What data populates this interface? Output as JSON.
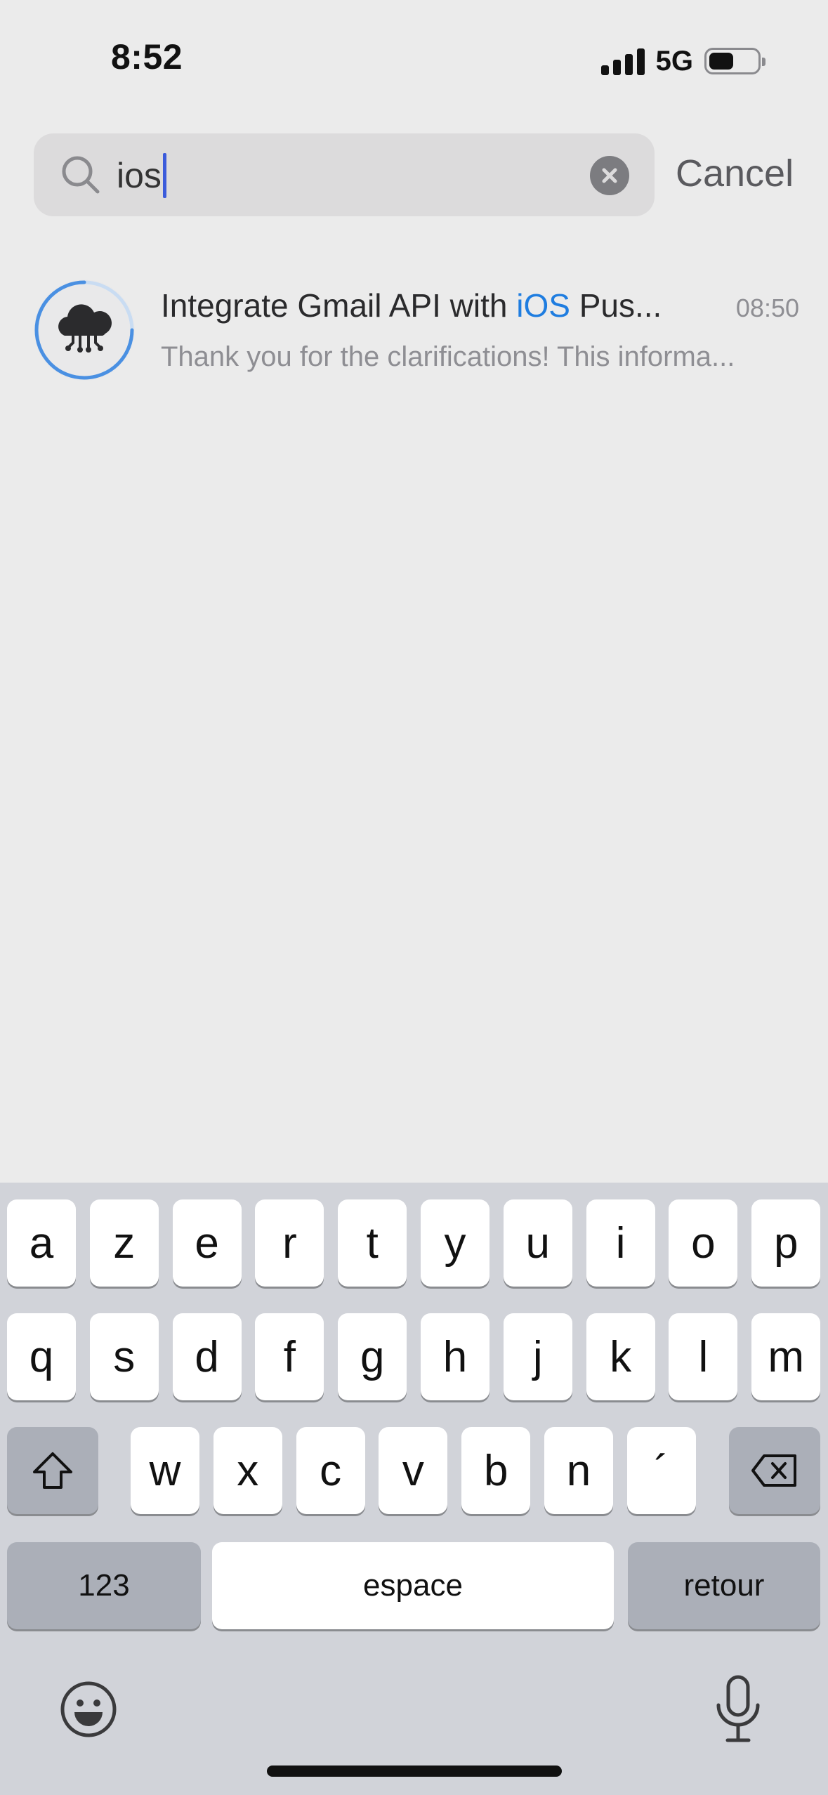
{
  "status_bar": {
    "time": "8:52",
    "network": "5G"
  },
  "search": {
    "query": "ios",
    "cancel_label": "Cancel"
  },
  "results": [
    {
      "title_before": "Integrate Gmail API with ",
      "title_highlight": "iOS",
      "title_after": " Pus...",
      "time": "08:50",
      "preview": "Thank you for the clarifications! This informa..."
    }
  ],
  "keyboard": {
    "row1": [
      "a",
      "z",
      "e",
      "r",
      "t",
      "y",
      "u",
      "i",
      "o",
      "p"
    ],
    "row2": [
      "q",
      "s",
      "d",
      "f",
      "g",
      "h",
      "j",
      "k",
      "l",
      "m"
    ],
    "row3": [
      "w",
      "x",
      "c",
      "v",
      "b",
      "n",
      "´"
    ],
    "numbers_label": "123",
    "space_label": "espace",
    "return_label": "retour"
  },
  "colors": {
    "highlight": "#1f7de0",
    "caret": "#3b5bdb",
    "avatar_ring": "#4a90e2"
  }
}
